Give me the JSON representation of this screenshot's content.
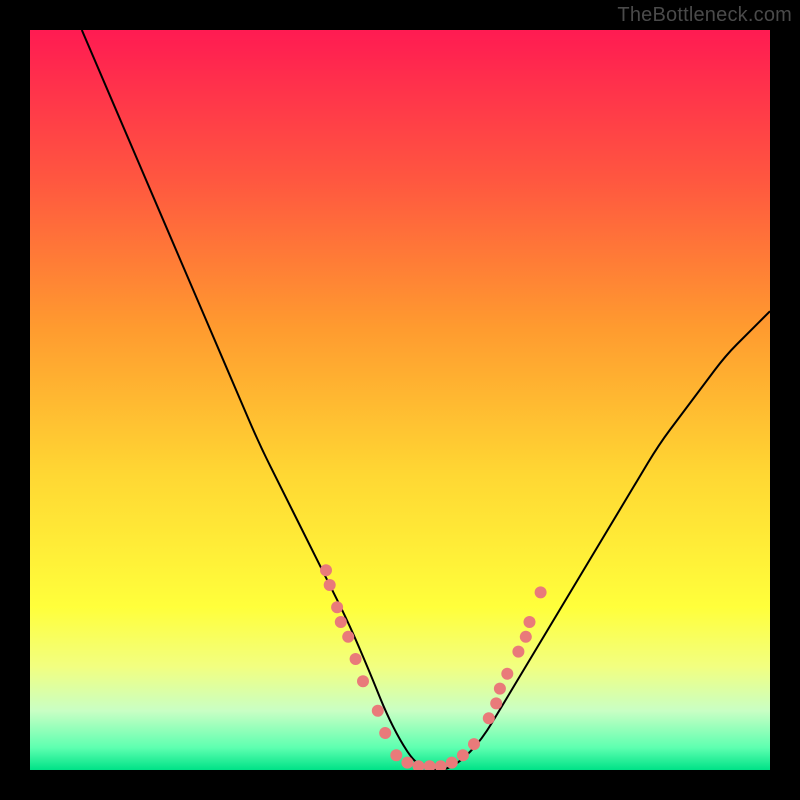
{
  "watermark": "TheBottleneck.com",
  "chart_data": {
    "type": "line",
    "title": "",
    "xlabel": "",
    "ylabel": "",
    "xlim": [
      0,
      100
    ],
    "ylim": [
      0,
      100
    ],
    "grid": false,
    "background_gradient": {
      "type": "vertical",
      "stops": [
        {
          "pos": 0.0,
          "color": "#ff1b52"
        },
        {
          "pos": 0.2,
          "color": "#ff5640"
        },
        {
          "pos": 0.4,
          "color": "#ff9a2f"
        },
        {
          "pos": 0.6,
          "color": "#ffd733"
        },
        {
          "pos": 0.78,
          "color": "#ffff3b"
        },
        {
          "pos": 0.86,
          "color": "#f2ff80"
        },
        {
          "pos": 0.92,
          "color": "#c9ffc4"
        },
        {
          "pos": 0.97,
          "color": "#5dffb0"
        },
        {
          "pos": 1.0,
          "color": "#00e287"
        }
      ]
    },
    "series": [
      {
        "name": "bottleneck-curve",
        "color": "#000000",
        "stroke_width": 2,
        "x": [
          7,
          10,
          13,
          16,
          19,
          22,
          25,
          28,
          31,
          34,
          37,
          40,
          43,
          46,
          48,
          50,
          52,
          54,
          56,
          58,
          61,
          64,
          67,
          70,
          73,
          76,
          79,
          82,
          85,
          88,
          91,
          94,
          97,
          100
        ],
        "y": [
          100,
          93,
          86,
          79,
          72,
          65,
          58,
          51,
          44,
          38,
          32,
          26,
          20,
          13,
          8,
          4,
          1,
          0,
          0,
          1,
          4,
          9,
          14,
          19,
          24,
          29,
          34,
          39,
          44,
          48,
          52,
          56,
          59,
          62
        ]
      }
    ],
    "highlight_points": {
      "name": "highlight-beads",
      "color": "#e97a7a",
      "radius": 6,
      "points": [
        {
          "x": 40.0,
          "y": 27
        },
        {
          "x": 40.5,
          "y": 25
        },
        {
          "x": 41.5,
          "y": 22
        },
        {
          "x": 42.0,
          "y": 20
        },
        {
          "x": 43.0,
          "y": 18
        },
        {
          "x": 44.0,
          "y": 15
        },
        {
          "x": 45.0,
          "y": 12
        },
        {
          "x": 47.0,
          "y": 8
        },
        {
          "x": 48.0,
          "y": 5
        },
        {
          "x": 49.5,
          "y": 2
        },
        {
          "x": 51.0,
          "y": 1
        },
        {
          "x": 52.5,
          "y": 0.5
        },
        {
          "x": 54.0,
          "y": 0.5
        },
        {
          "x": 55.5,
          "y": 0.5
        },
        {
          "x": 57.0,
          "y": 1
        },
        {
          "x": 58.5,
          "y": 2
        },
        {
          "x": 60.0,
          "y": 3.5
        },
        {
          "x": 62.0,
          "y": 7
        },
        {
          "x": 63.0,
          "y": 9
        },
        {
          "x": 63.5,
          "y": 11
        },
        {
          "x": 64.5,
          "y": 13
        },
        {
          "x": 66.0,
          "y": 16
        },
        {
          "x": 67.0,
          "y": 18
        },
        {
          "x": 67.5,
          "y": 20
        },
        {
          "x": 69.0,
          "y": 24
        }
      ]
    }
  }
}
